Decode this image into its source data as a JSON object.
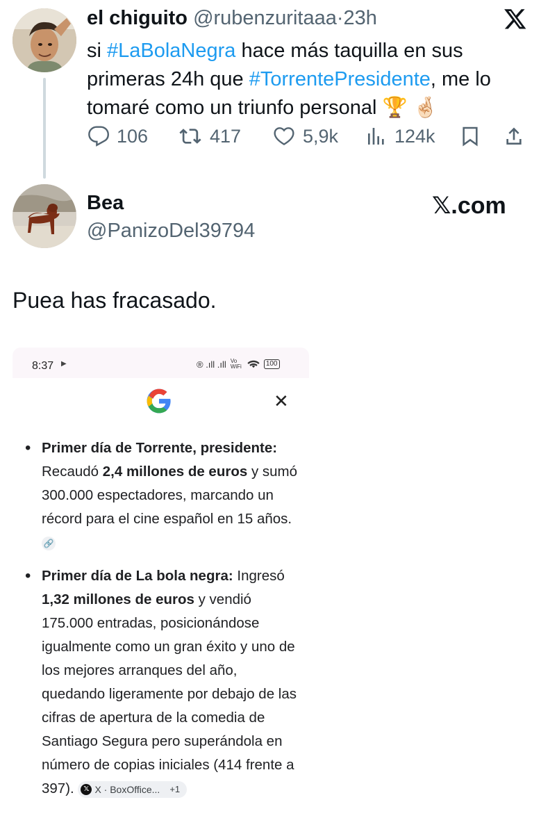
{
  "tweet": {
    "author_name": "el chiguito",
    "handle": "@rubenzuritaaa",
    "separator": "·",
    "time": "23h",
    "text_parts": [
      {
        "text": "si ",
        "type": "plain"
      },
      {
        "text": "#LaBolaNegra",
        "type": "hashtag"
      },
      {
        "text": " hace más taquilla en sus primeras 24h que ",
        "type": "plain"
      },
      {
        "text": "#TorrentePresidente",
        "type": "hashtag"
      },
      {
        "text": ", me lo tomaré como un triunfo personal 🏆 🤞🏻",
        "type": "plain"
      }
    ],
    "stats": {
      "replies": "106",
      "reposts": "417",
      "likes": "5,9k",
      "views": "124k"
    },
    "icons": [
      "x-logo-icon",
      "reply-icon",
      "repost-icon",
      "like-icon",
      "views-icon",
      "bookmark-icon",
      "share-icon"
    ]
  },
  "reply": {
    "author_name": "Bea",
    "handle": "@PanizoDel39794",
    "watermark": "𝕏.com",
    "text": "Puea has fracasado."
  },
  "embedded_screenshot": {
    "status_time": "8:37",
    "status_play": "▶",
    "status_icons_text": "® .ıll .ıll",
    "status_wifi_label": "Vo WiFi",
    "battery": "100",
    "close": "✕",
    "bullets": [
      {
        "parts": [
          {
            "text": "Primer día de Torrente, presidente:",
            "bold": true
          },
          {
            "text": " Recaudó ",
            "bold": false
          },
          {
            "text": "2,4 millones de euros",
            "bold": true
          },
          {
            "text": " y sumó 300.000 espectadores, marcando un récord para el cine español en 15 años.",
            "bold": false
          }
        ],
        "link_chip": "🔗"
      },
      {
        "parts": [
          {
            "text": "Primer día de La bola negra:",
            "bold": true
          },
          {
            "text": " Ingresó ",
            "bold": false
          },
          {
            "text": "1,32 millones de euros",
            "bold": true
          },
          {
            "text": " y vendió 175.000 entradas, posicionándose igualmente como un gran éxito y uno de los mejores arranques del año, quedando ligeramente por debajo de las cifras de apertura de la comedia de Santiago Segura pero superándola en número de copias iniciales (414 frente a 397).",
            "bold": false
          }
        ],
        "source_chip": "X · BoxOffice...",
        "source_extra": "+1"
      }
    ]
  },
  "colors": {
    "hashtag": "#1d9bf0",
    "muted": "#536471",
    "thread_line": "#cfd9de"
  }
}
